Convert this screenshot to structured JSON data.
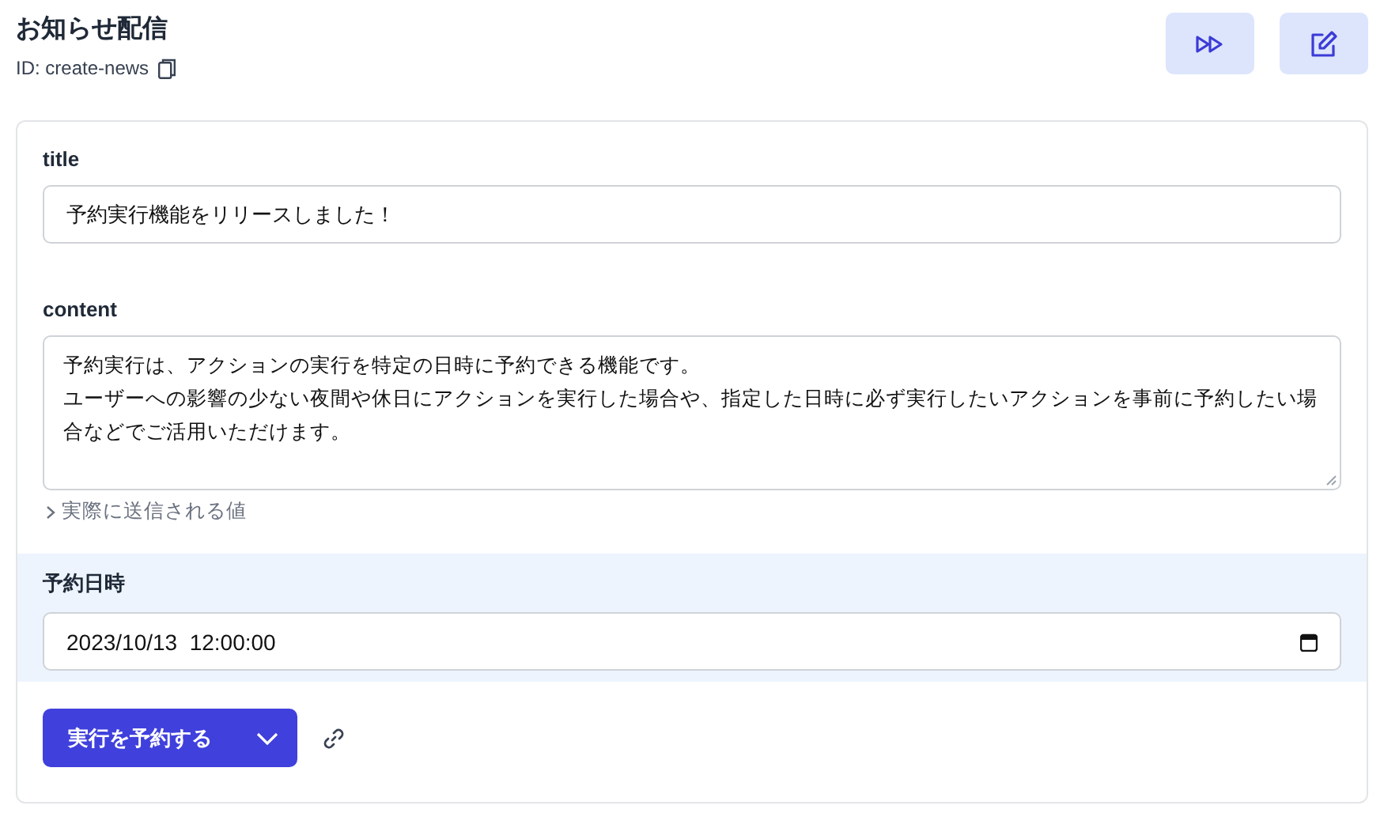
{
  "header": {
    "title": "お知らせ配信",
    "id_text": "ID: create-news"
  },
  "fields": [
    {
      "kind": "text",
      "label": "title",
      "value": "予約実行機能をリリースしました！"
    },
    {
      "kind": "textarea",
      "label": "content",
      "paragraphs": [
        "予約実行は、アクションの実行を特定の日時に予約できる機能です。",
        "ユーザーへの影響の少ない夜間や休日にアクションを実行した場合や、指定した日時に必ず実行したいアクションを事前に予約したい場合などでご活用いただけます。"
      ],
      "toggle": "実際に送信される値"
    }
  ],
  "schedule": {
    "label": "予約日時",
    "value": "2023/10/13  12:00:00"
  },
  "submit": {
    "label": "実行を予約する"
  }
}
